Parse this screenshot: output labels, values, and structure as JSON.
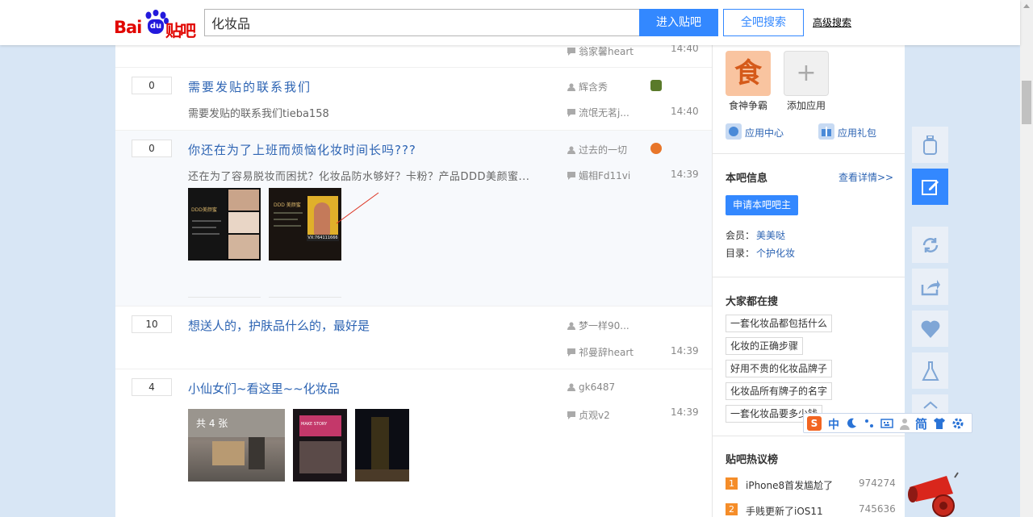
{
  "header": {
    "logo_bai": "Bai",
    "logo_du": "du",
    "logo_tieba": "贴吧",
    "search_value": "化妆品",
    "enter_bar_label": "进入贴吧",
    "all_search_label": "全吧搜索",
    "advanced_search_label": "高级搜索"
  },
  "threads": [
    {
      "reply_count": "",
      "title": "",
      "last_replier": "翁家馨heart",
      "last_time": "14:40"
    },
    {
      "reply_count": "0",
      "title": "需要发贴的联系我们",
      "abstract": "需要发贴的联系我们tieba158",
      "author": "辉含秀",
      "last_replier": "流氓无茗j...",
      "last_time": "14:40"
    },
    {
      "reply_count": "0",
      "title": "你还在为了上班而烦恼化妆时间长吗???",
      "abstract": "还在为了容易脱妆而困扰？化妆品防水够好？卡粉？产品DDD美颜蜜...",
      "author": "过去的一切",
      "last_replier": "媚相Fd11vi",
      "last_time": "14:39",
      "img1_text": "DDD美颜蜜",
      "img2_text": "DDD 美颜蜜",
      "img2_caption": "VX:764111666"
    },
    {
      "reply_count": "10",
      "title": "想送人的，护肤品什么的，最好是",
      "author": "梦一样90...",
      "last_replier": "祁曼辞heart",
      "last_time": "14:39"
    },
    {
      "reply_count": "4",
      "title": "小仙女们~看这里~~化妆品",
      "author": "gk6487",
      "last_replier": "贞观v2",
      "last_time": "14:39",
      "img_count_label": "共 4 张",
      "img2_text": "MAKE STORY"
    }
  ],
  "sidebar": {
    "apps": [
      {
        "label": "食神争霸",
        "glyph": "食"
      },
      {
        "label": "添加应用",
        "glyph": "+"
      }
    ],
    "app_center_label": "应用中心",
    "app_gift_label": "应用礼包",
    "bar_info": {
      "heading": "本吧信息",
      "details_link": "查看详情>>",
      "apply_button": "申请本吧吧主",
      "member_label": "会员：",
      "member_value": "美美哒",
      "dir_label": "目录：",
      "dir_value": "个护化妆"
    },
    "everyone_search": {
      "heading": "大家都在搜",
      "tags": [
        "一套化妆品都包括什么",
        "化妆的正确步骤",
        "好用不贵的化妆品牌子",
        "化妆品所有牌子的名字",
        "一套化妆品要多少钱"
      ]
    },
    "hot_topics": {
      "heading": "贴吧热议榜",
      "items": [
        {
          "rank": "1",
          "title": "iPhone8首发尴尬了",
          "value": "974274"
        },
        {
          "rank": "2",
          "title": "手贱更新了iOS11",
          "value": "745636"
        }
      ]
    }
  },
  "ime": {
    "mode_label": "中",
    "simplified_label": "简"
  },
  "colors": {
    "brand_blue": "#3388ff",
    "link_blue": "#2d64b3",
    "page_bg": "#d8e6f5",
    "rank_orange": "#f58d29"
  }
}
